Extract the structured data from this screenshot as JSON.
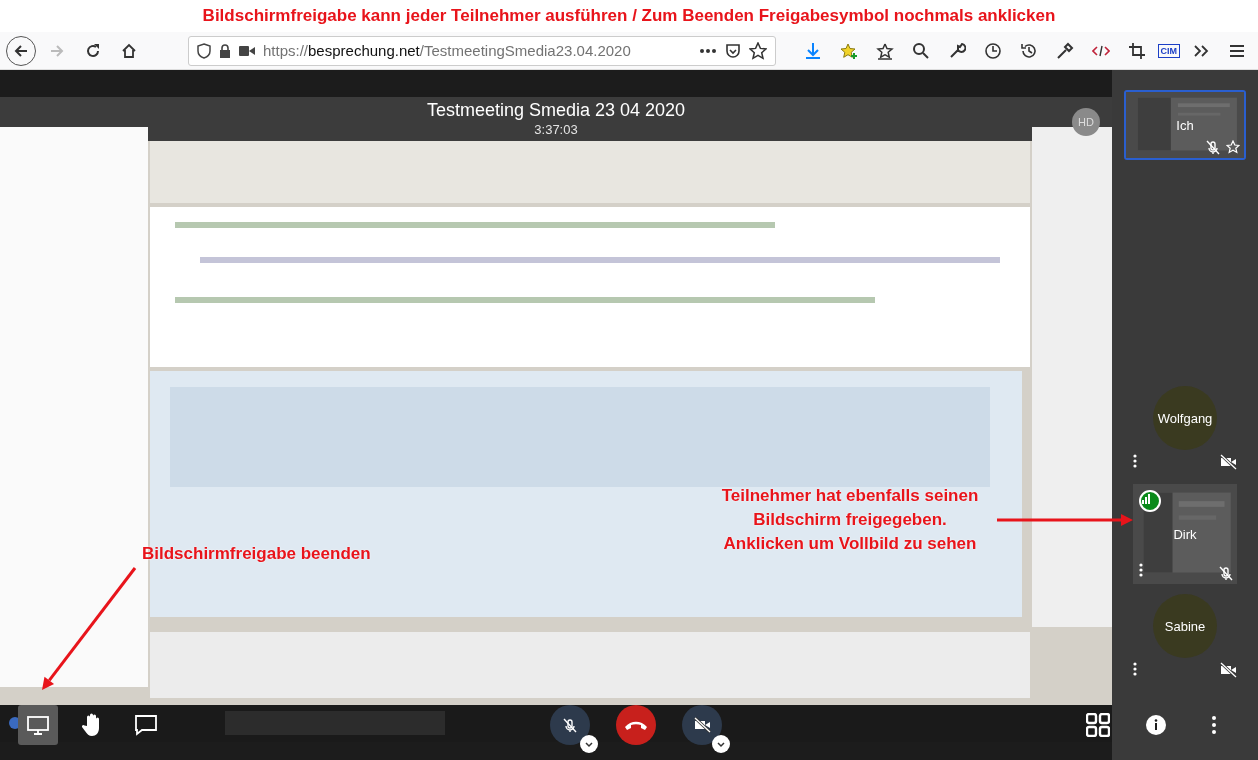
{
  "caption": "Bildschirmfreigabe kann jeder Teilnehmer ausführen / Zum Beenden Freigabesymbol nochmals anklicken",
  "browser": {
    "url": {
      "scheme": "https://",
      "host": "besprechung.net",
      "path": "/TestmeetingSmedia23.04.2020"
    },
    "forward_disabled": true,
    "extension_label": "CIM"
  },
  "meeting": {
    "title": "Testmeeting Smedia 23 04 2020",
    "timer": "3:37:03",
    "quality_badge": "HD"
  },
  "annotations": [
    {
      "lines": [
        "Teilnehmer hat ebenfalls seinen",
        "Bildschirm freigegeben.",
        "Anklicken um Vollbild zu sehen"
      ]
    },
    {
      "lines": [
        "Bildschirmfreigabe beenden"
      ]
    }
  ],
  "toolbar": {
    "screen_share_on": true,
    "microphone_muted": true,
    "camera_muted": true
  },
  "participants": [
    {
      "kind": "video",
      "name": "Ich",
      "selected": true,
      "audio_muted": true,
      "video_muted": false,
      "moderator": true,
      "connection_indicator": false
    },
    {
      "kind": "avatar",
      "name": "Wolfgang",
      "selected": false,
      "audio_muted": false,
      "video_muted": true,
      "moderator": false,
      "connection_indicator": false
    },
    {
      "kind": "video",
      "name": "Dirk",
      "selected": false,
      "audio_muted": true,
      "video_muted": false,
      "moderator": false,
      "connection_indicator": true
    },
    {
      "kind": "avatar",
      "name": "Sabine",
      "selected": false,
      "audio_muted": false,
      "video_muted": true,
      "moderator": false,
      "connection_indicator": false
    }
  ]
}
